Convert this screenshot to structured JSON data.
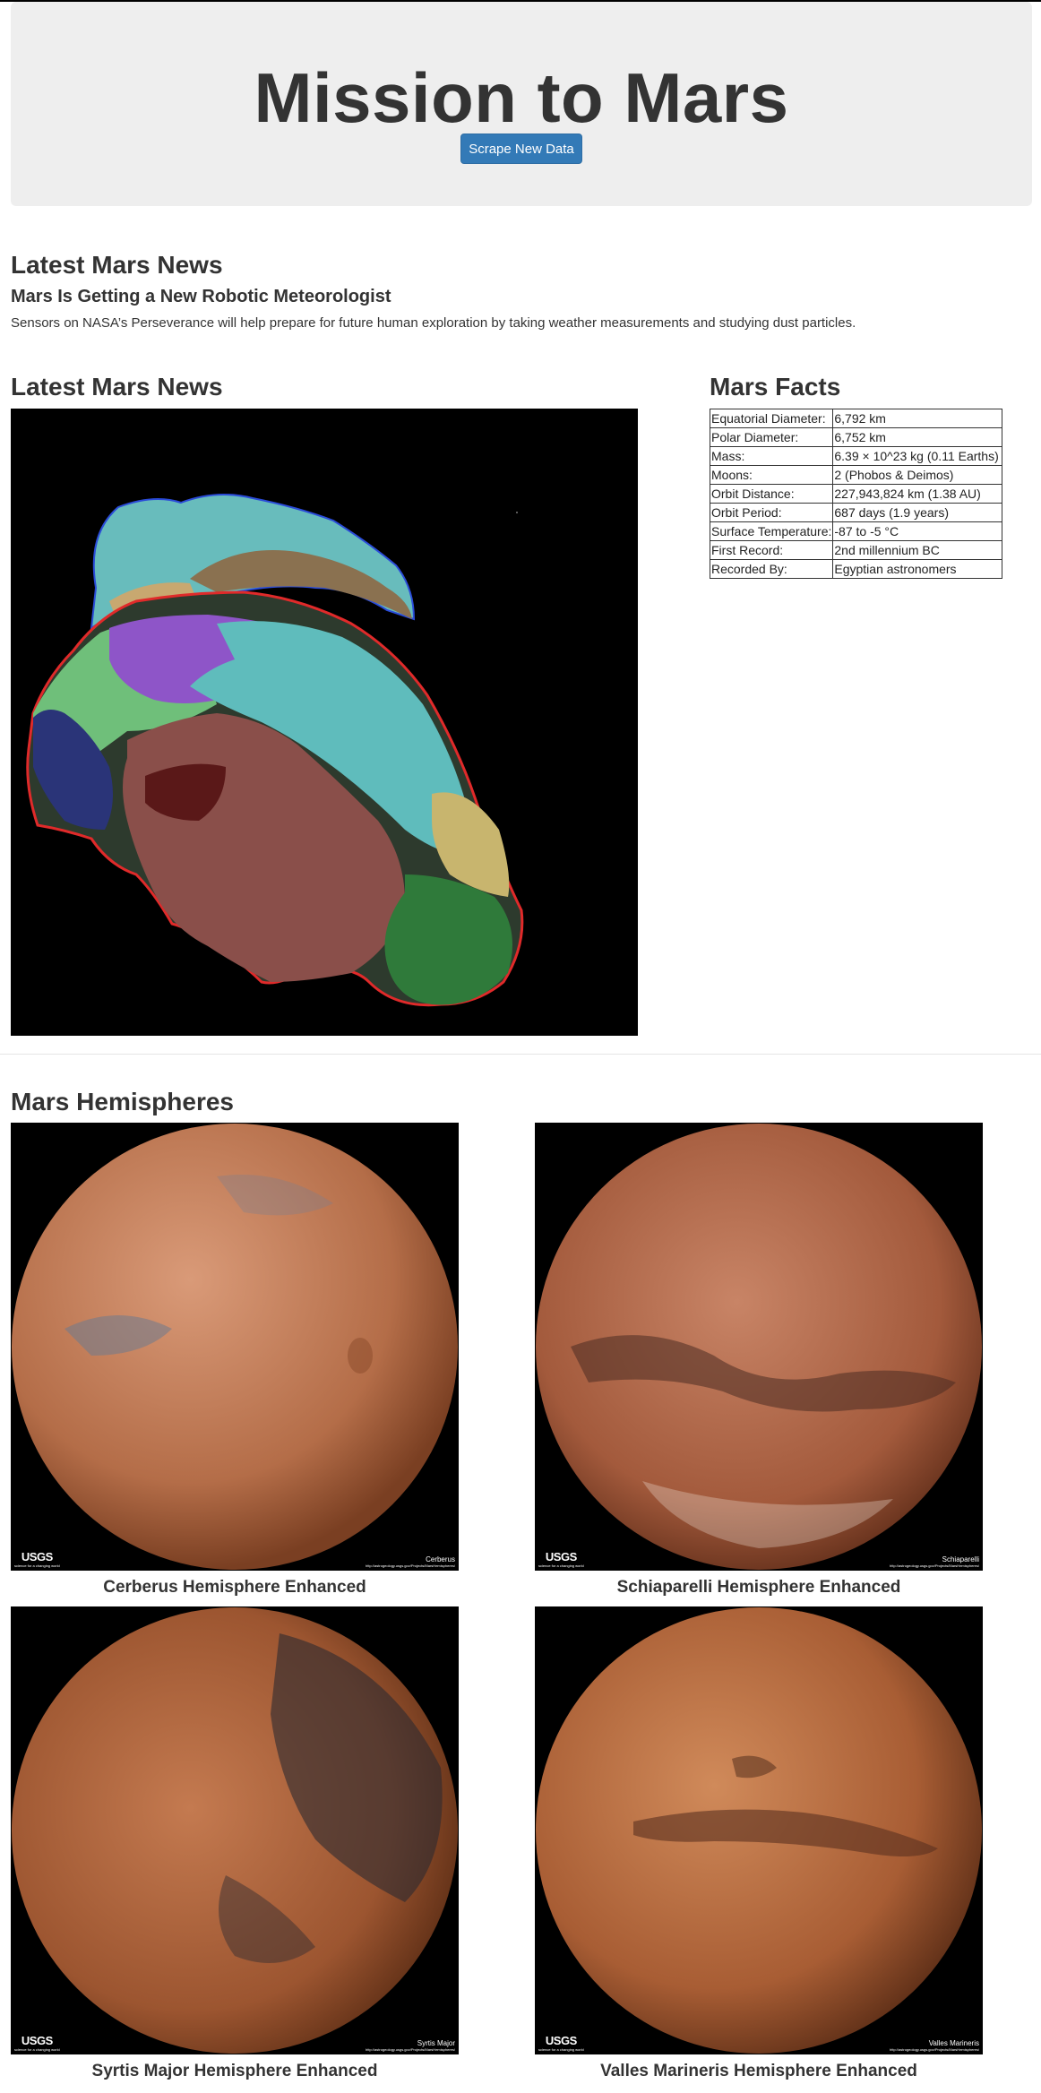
{
  "header": {
    "title": "Mission to Mars",
    "scrape_button": "Scrape New Data"
  },
  "news": {
    "section_title": "Latest Mars News",
    "title": "Mars Is Getting a New Robotic Meteorologist",
    "paragraph": "Sensors on NASA’s Perseverance will help prepare for future human exploration by taking weather measurements and studying dust particles."
  },
  "featured": {
    "section_title": "Latest Mars News"
  },
  "facts": {
    "section_title": "Mars Facts",
    "rows": [
      {
        "label": "Equatorial Diameter:",
        "value": "6,792 km"
      },
      {
        "label": "Polar Diameter:",
        "value": "6,752 km"
      },
      {
        "label": "Mass:",
        "value": "6.39 × 10^23 kg (0.11 Earths)"
      },
      {
        "label": "Moons:",
        "value": "2 (Phobos & Deimos)"
      },
      {
        "label": "Orbit Distance:",
        "value": "227,943,824 km (1.38 AU)"
      },
      {
        "label": "Orbit Period:",
        "value": "687 days (1.9 years)"
      },
      {
        "label": "Surface Temperature:",
        "value": "-87 to -5 °C"
      },
      {
        "label": "First Record:",
        "value": "2nd millennium BC"
      },
      {
        "label": "Recorded By:",
        "value": "Egyptian astronomers"
      }
    ]
  },
  "hemispheres": {
    "section_title": "Mars Hemispheres",
    "logo_text": "USGS",
    "logo_tagline": "science for a changing world",
    "credit_url": "http://astrogeology.usgs.gov/Projects/MarsHemispheres/",
    "items": [
      {
        "title": "Cerberus Hemisphere Enhanced",
        "label": "Cerberus"
      },
      {
        "title": "Schiaparelli Hemisphere Enhanced",
        "label": "Schiaparelli"
      },
      {
        "title": "Syrtis Major Hemisphere Enhanced",
        "label": "Syrtis Major"
      },
      {
        "title": "Valles Marineris Hemisphere Enhanced",
        "label": "Valles Marineris"
      }
    ]
  },
  "colors": {
    "button": "#337ab7",
    "jumbotron": "#eeeeee",
    "text": "#333333"
  }
}
